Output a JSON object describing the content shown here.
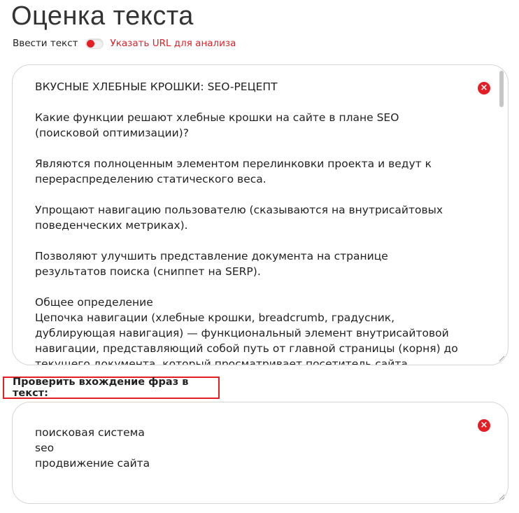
{
  "page": {
    "title": "Оценка текста"
  },
  "mode": {
    "left_label": "Ввести текст",
    "right_label": "Указать URL для анализа"
  },
  "text_input": {
    "paragraphs": [
      "ВКУСНЫЕ ХЛЕБНЫЕ КРОШКИ: SEO-РЕЦЕПТ",
      "Какие функции решают хлебные крошки на сайте в плане SEO (поисковой оптимизации)?",
      "Являются полноценным элементом перелинковки проекта и ведут к перераспределению статического веса.",
      "Упрощают навигацию пользователю (сказываются на внутрисайтовых поведенческих метриках).",
      "Позволяют улучшить представление документа на странице результатов поиска (сниппет на SERP).",
      "Общее определение\nЦепочка навигации (хлебные крошки, breadcrumb, градусник, дублирующая навигация) — функциональный элемент внутрисайтовой навигации, представляющий собой путь от главной страницы (корня) до текущего документа, который просматривает посетитель сайта."
    ],
    "clear_symbol": "×"
  },
  "phrases": {
    "header": "Проверить вхождение фраз в текст:",
    "lines": [
      "поисковая система",
      "seo",
      "продвижение сайта"
    ],
    "clear_symbol": "×"
  },
  "colors": {
    "accent": "#e31e24",
    "border": "#d6d6d6",
    "scrollbar": "#c6c6c6"
  }
}
